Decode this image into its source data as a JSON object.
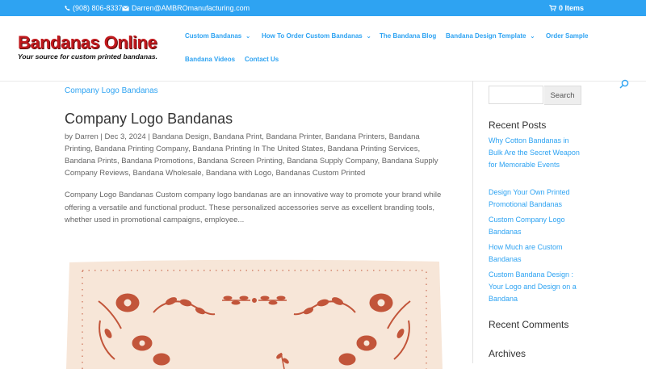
{
  "topbar": {
    "phone": "(908) 806-8337",
    "email": "Darren@AMBROmanufacturing.com",
    "cart": "0 Items"
  },
  "logo": {
    "name": "Bandanas Online",
    "tagline": "Your source for custom printed bandanas."
  },
  "nav": {
    "items": [
      {
        "label": "Custom Bandanas",
        "dropdown": true
      },
      {
        "label": "How To Order Custom Bandanas",
        "dropdown": true
      },
      {
        "label": "The Bandana Blog",
        "dropdown": false
      },
      {
        "label": "Bandana Design Template",
        "dropdown": true
      },
      {
        "label": "Order Sample",
        "dropdown": false
      },
      {
        "label": "Bandana Videos",
        "dropdown": false
      },
      {
        "label": "Contact Us",
        "dropdown": false
      }
    ]
  },
  "post": {
    "breadcrumb": "Company Logo Bandanas",
    "title": "Company Logo Bandanas",
    "meta_by": "by",
    "author": "Darren",
    "date": "Dec 3, 2024",
    "categories": [
      "Bandana Design",
      "Bandana Print",
      "Bandana Printer",
      "Bandana Printers",
      "Bandana Printing",
      "Bandana Printing Company",
      "Bandana Printing In The United States",
      "Bandana Printing Services",
      "Bandana Prints",
      "Bandana Promotions",
      "Bandana Screen Printing",
      "Bandana Supply Company",
      "Bandana Supply Company Reviews",
      "Bandana Wholesale",
      "Bandana with Logo",
      "Bandanas Custom Printed"
    ],
    "excerpt": "Company Logo Bandanas Custom company logo bandanas are an innovative way to promote your brand while offering a versatile and functional product. These personalized accessories serve as excellent branding tools, whether used in promotional campaigns, employee..."
  },
  "sidebar": {
    "search_button": "Search",
    "recent_posts_title": "Recent Posts",
    "recent_posts": [
      "Why Cotton Bandanas in Bulk Are the Secret Weapon for Memorable Events",
      "Design Your Own Printed Promotional Bandanas",
      "Custom Company Logo Bandanas",
      "How Much are Custom Bandanas",
      "Custom Bandana Design : Your Logo and Design on a Bandana"
    ],
    "recent_comments_title": "Recent Comments",
    "archives_title": "Archives"
  },
  "colors": {
    "accent": "#2ea3f2",
    "logo_red": "#c0191d",
    "bandana_fabric": "#f7e6d8",
    "bandana_motif": "#c2553a"
  },
  "icons": {
    "phone": "phone-icon",
    "email": "envelope-icon",
    "cart": "cart-icon",
    "search": "search-icon"
  }
}
